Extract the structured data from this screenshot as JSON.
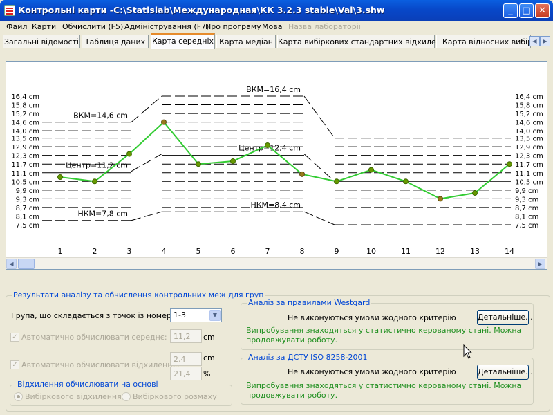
{
  "window": {
    "title": "Контрольні карти -C:\\Statislab\\Международная\\КК 3.2.3 stable\\Val\\3.shw"
  },
  "menu": [
    "Файл",
    "Карти",
    "Обчислити (F5)",
    "Адміністрування (F7)",
    "Про програму",
    "Мова",
    "Назва лабораторії"
  ],
  "tabs": [
    "Загальні відомості",
    "Таблиця даних",
    "Карта середніх",
    "Карта медіан",
    "Карта вибіркових стандартних відхилень",
    "Карта відносних вибірко"
  ],
  "chart_data": {
    "type": "line",
    "x": [
      1,
      2,
      3,
      4,
      5,
      6,
      7,
      8,
      9,
      10,
      11,
      12,
      13,
      14
    ],
    "series": [
      {
        "values": [
          10.8,
          10.5,
          12.4,
          14.6,
          11.7,
          11.9,
          13.0,
          11.0,
          10.5,
          11.3,
          10.5,
          9.3,
          9.7,
          11.7
        ]
      }
    ],
    "ylim": [
      7.5,
      16.4
    ],
    "ytick_values": [
      7.5,
      8.1,
      8.7,
      9.3,
      9.9,
      10.5,
      11.1,
      11.7,
      12.3,
      12.9,
      13.5,
      14.0,
      14.6,
      15.2,
      15.8,
      16.4
    ],
    "ytick_labels": [
      "7,5 cm",
      "8,1 cm",
      "8,7 cm",
      "9,3 cm",
      "9,9 cm",
      "10,5 cm",
      "11,1 cm",
      "11,7 cm",
      "12,3 cm",
      "12,9 cm",
      "13,5 cm",
      "14,0 cm",
      "14,6 cm",
      "15,2 cm",
      "15,8 cm",
      "16,4 cm"
    ],
    "groups": [
      {
        "from": 1,
        "to": 3,
        "ucl": 14.6,
        "center": 11.2,
        "lcl": 7.8,
        "ucl_label": "ВКМ=14,6 cm",
        "center_label": "Центр=11,2 cm",
        "lcl_label": "НКМ=7,8 cm"
      },
      {
        "from": 4,
        "to": 8,
        "ucl": 16.4,
        "center": 12.4,
        "lcl": 8.4,
        "ucl_label": "ВКМ=16,4 cm",
        "center_label": "Центр=12,4 cm",
        "lcl_label": "НКМ=8,4 cm"
      },
      {
        "from": 9,
        "to": 14,
        "ucl": 13.5,
        "center": 10.5,
        "lcl": 7.5
      }
    ],
    "colors": {
      "line": "#33cc33",
      "point": "#669900",
      "highlight": "#997a1a"
    }
  },
  "results": {
    "title": "Результати аналізу та обчислення контрольних меж для груп",
    "group_label": "Група, що складається з точок із номерами:",
    "group_value": "1-3",
    "auto_mean_label": "Автоматично обчислювати середнє:",
    "mean_value": "11,2",
    "mean_unit": "cm",
    "auto_dev_label": "Автоматично обчислювати відхилення:",
    "dev_value": "2,4",
    "dev_unit": "cm",
    "dev_pct": "21,4",
    "pct_unit": "%",
    "dev_basis_title": "Відхилення обчислювати на основі",
    "radio1": "Вибіркового відхилення",
    "radio2": "Вибіркового розмаху"
  },
  "westgard": {
    "title": "Аналіз за правилами Westgard",
    "status": "Не виконуються умови жодного критерію",
    "button": "Детальніше...",
    "message": "Випробування знаходяться у статистично керованому стані. Можна продовжувати роботу."
  },
  "dstu": {
    "title": "Аналіз за ДСТУ ISO 8258-2001",
    "status": "Не виконуються умови жодного критерію",
    "button": "Детальніше...",
    "message": "Випробування знаходяться у статистично керованому стані. Можна продовжувати роботу."
  }
}
